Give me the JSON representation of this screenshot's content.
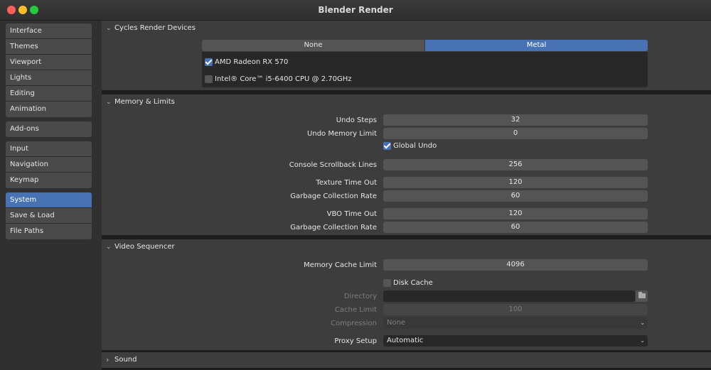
{
  "window": {
    "title": "Blender Render"
  },
  "sidebar": {
    "groups": [
      [
        "Interface",
        "Themes",
        "Viewport",
        "Lights",
        "Editing",
        "Animation"
      ],
      [
        "Add-ons"
      ],
      [
        "Input",
        "Navigation",
        "Keymap"
      ],
      [
        "System",
        "Save & Load",
        "File Paths"
      ]
    ],
    "active": "System"
  },
  "cycles": {
    "header": "Cycles Render Devices",
    "tabs": [
      "None",
      "Metal"
    ],
    "active_tab": "Metal",
    "devices": [
      {
        "label": "AMD Radeon RX 570",
        "checked": true
      },
      {
        "label": "Intel® Core™ i5-6400 CPU @ 2.70GHz",
        "checked": false
      }
    ]
  },
  "memory": {
    "header": "Memory & Limits",
    "undo_steps_label": "Undo Steps",
    "undo_steps": "32",
    "undo_mem_label": "Undo Memory Limit",
    "undo_mem": "0",
    "global_undo_label": "Global Undo",
    "global_undo": true,
    "console_label": "Console Scrollback Lines",
    "console": "256",
    "tex_timeout_label": "Texture Time Out",
    "tex_timeout": "120",
    "gc_rate_label": "Garbage Collection Rate",
    "gc_rate": "60",
    "vbo_timeout_label": "VBO Time Out",
    "vbo_timeout": "120",
    "gc_rate2_label": "Garbage Collection Rate",
    "gc_rate2": "60"
  },
  "sequencer": {
    "header": "Video Sequencer",
    "mem_cache_label": "Memory Cache Limit",
    "mem_cache": "4096",
    "disk_cache_label": "Disk Cache",
    "disk_cache": false,
    "directory_label": "Directory",
    "directory": "",
    "cache_limit_label": "Cache Limit",
    "cache_limit": "100",
    "compression_label": "Compression",
    "compression": "None",
    "proxy_label": "Proxy Setup",
    "proxy": "Automatic"
  },
  "sound": {
    "header": "Sound"
  },
  "colors": {
    "accent": "#4772b3",
    "panel": "#3d3d3d",
    "field": "#545454"
  }
}
